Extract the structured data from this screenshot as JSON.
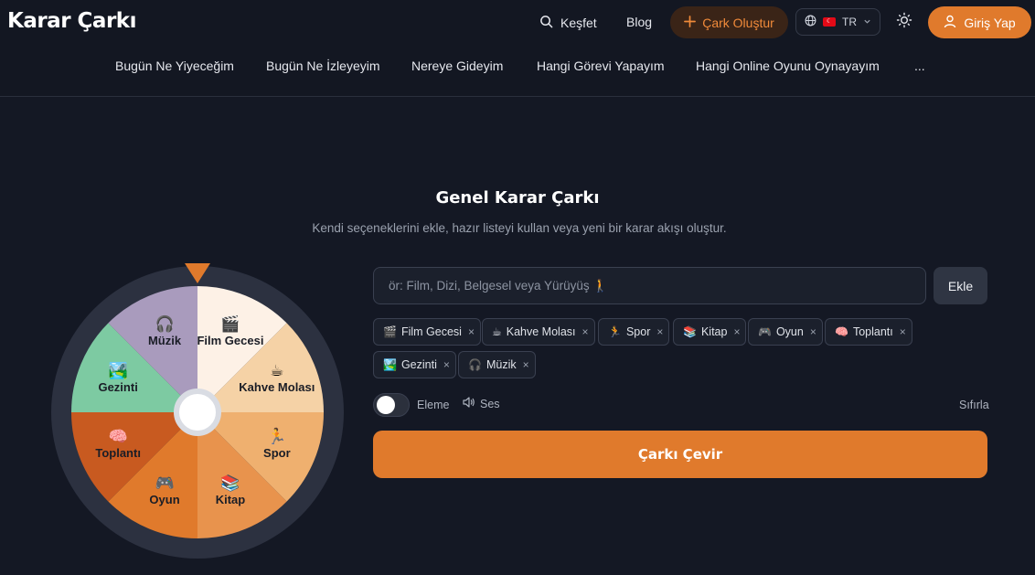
{
  "header": {
    "logo": "Karar Çarkı",
    "explore": "Keşfet",
    "blog": "Blog",
    "create": "Çark Oluştur",
    "lang": "TR",
    "login": "Giriş Yap",
    "colors": {
      "accent": "#e07a2c",
      "accent_dark_bg": "#3a2417"
    }
  },
  "categories": [
    "Bugün Ne Yiyeceğim",
    "Bugün Ne İzleyeyim",
    "Nereye Gideyim",
    "Hangi Görevi Yapayım",
    "Hangi Online Oyunu Oynayayım",
    "..."
  ],
  "main": {
    "title": "Genel Karar Çarkı",
    "subtitle": "Kendi seçeneklerini ekle, hazır listeyi kullan veya yeni bir karar akışı oluştur.",
    "input_placeholder": "ör: Film, Dizi, Belgesel veya Yürüyüş 🚶",
    "add": "Ekle",
    "elimination": "Eleme",
    "sound": "Ses",
    "reset": "Sıfırla",
    "spin": "Çarkı Çevir"
  },
  "options": [
    {
      "label": "Film Gecesi",
      "icon": "🎬",
      "color": "#fdf1e6"
    },
    {
      "label": "Kahve Molası",
      "icon": "☕",
      "color": "#f5d2a6"
    },
    {
      "label": "Spor",
      "icon": "🏃",
      "color": "#efb06f"
    },
    {
      "label": "Kitap",
      "icon": "📚",
      "color": "#e8934d"
    },
    {
      "label": "Oyun",
      "icon": "🎮",
      "color": "#e07a2c"
    },
    {
      "label": "Toplantı",
      "icon": "🧠",
      "color": "#c85a20"
    },
    {
      "label": "Gezinti",
      "icon": "🏞️",
      "color": "#7dcaa2"
    },
    {
      "label": "Müzik",
      "icon": "🎧",
      "color": "#a99bbd"
    }
  ]
}
